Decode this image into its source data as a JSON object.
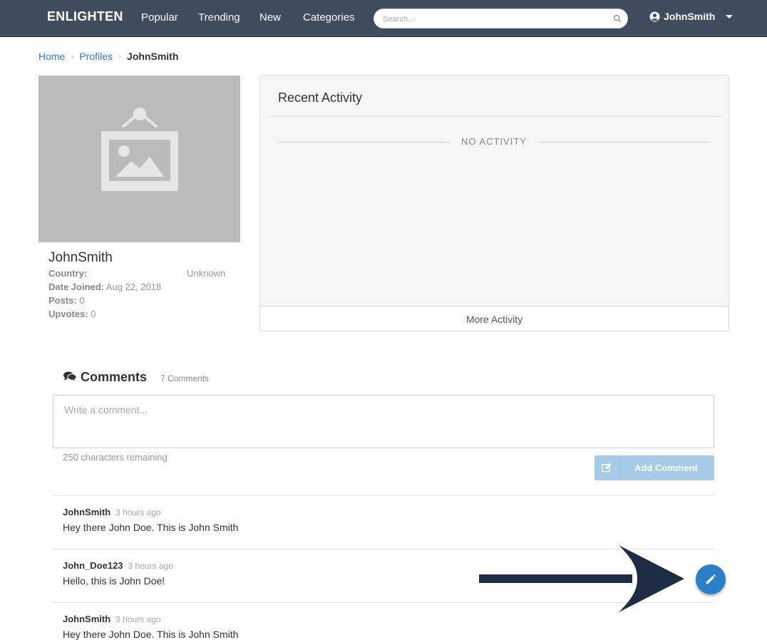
{
  "navbar": {
    "brand": "ENLIGHTEN",
    "links": [
      "Popular",
      "Trending",
      "New",
      "Categories"
    ],
    "search_placeholder": "Search...",
    "user": "JohnSmith",
    "icons": {
      "search": "search-icon",
      "user": "user-circle-icon",
      "caret": "caret-down-icon"
    }
  },
  "breadcrumb": {
    "items": [
      "Home",
      "Profiles"
    ],
    "current": "JohnSmith"
  },
  "profile": {
    "avatar_icon": "image-placeholder-icon",
    "username": "JohnSmith",
    "country_label": "Country:",
    "country_value": "Unknown",
    "date_joined_label": "Date Joined:",
    "date_joined_value": "Aug 22, 2018",
    "posts_label": "Posts:",
    "posts_value": "0",
    "upvotes_label": "Upvotes:",
    "upvotes_value": "0"
  },
  "activity": {
    "title": "Recent Activity",
    "empty_text": "NO ACTIVITY",
    "more_label": "More Activity"
  },
  "comments": {
    "title": "Comments",
    "count": "7 Comments",
    "placeholder": "Write a comment...",
    "chars_remaining": "250 characters remaining",
    "add_label": "Add Comment",
    "items": [
      {
        "author": "JohnSmith",
        "time": "3 hours ago",
        "text": "Hey there John Doe. This is John Smith"
      },
      {
        "author": "John_Doe123",
        "time": "3 hours ago",
        "text": "Hello, this is John Doe!"
      },
      {
        "author": "JohnSmith",
        "time": "3 hours ago",
        "text": "Hey there John Doe. This is John Smith"
      }
    ]
  },
  "colors": {
    "navbar": "#3f4c5f",
    "link": "#3a78b8",
    "button": "#a6cbe8",
    "fab": "#2b7fc6",
    "arrow": "#1f2d44"
  },
  "fab_icon": "pencil-icon"
}
